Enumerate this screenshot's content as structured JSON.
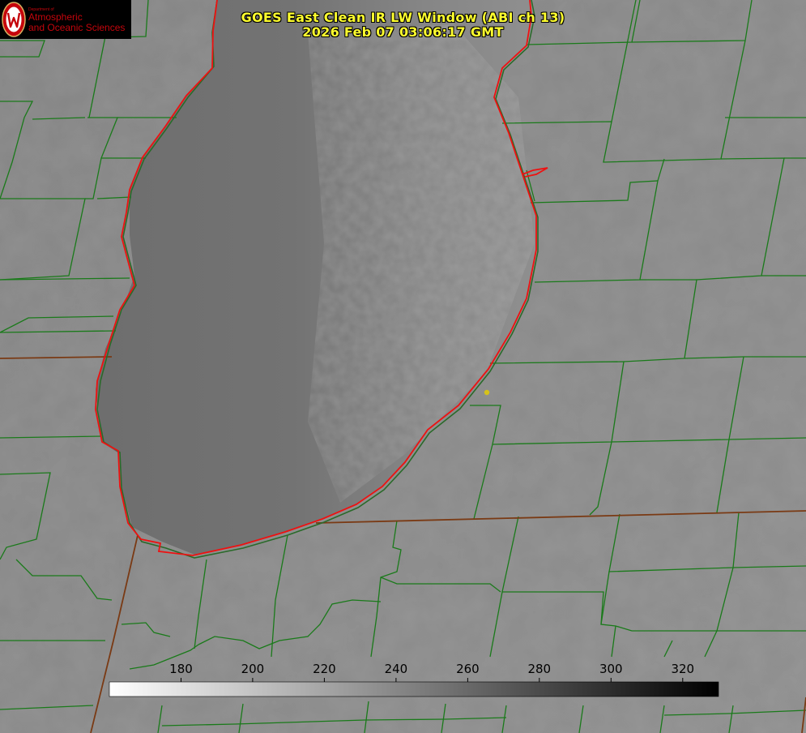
{
  "product": {
    "title": "GOES East Clean IR LW Window (ABI ch 13)",
    "timestamp": "2026 Feb 07 03:06:17 GMT"
  },
  "logo": {
    "department": "Department of",
    "line1": "Atmospheric",
    "line2": "and Oceanic Sciences",
    "seal_letter": "W",
    "color": "#c5050c"
  },
  "colorbar": {
    "units_hint": "",
    "min": 160,
    "max": 330,
    "ticks": [
      180,
      200,
      220,
      240,
      260,
      280,
      300,
      320
    ],
    "from_color": "#ffffff",
    "to_color": "#000000"
  },
  "overlays": {
    "county_line_color": "#1a7a1a",
    "state_line_color": "#7a3a14",
    "lake_outline_color": "#ee1111",
    "marker_color": "#d6c21a"
  },
  "map": {
    "subject": "Lake Michigan region",
    "marker": "yellow-dot"
  }
}
